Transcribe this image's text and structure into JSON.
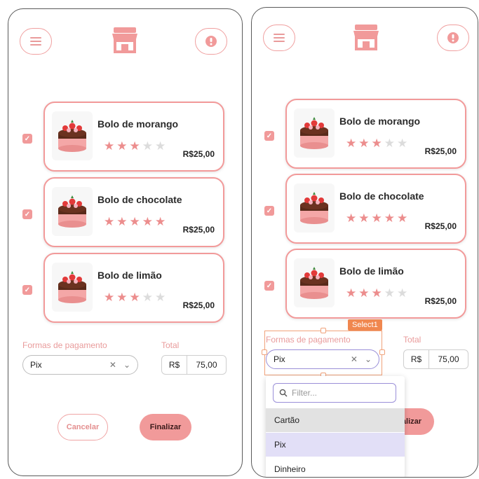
{
  "left_screen": {
    "products": [
      {
        "name": "Bolo de morango",
        "rating": 3,
        "price": "R$25,00",
        "checked": true
      },
      {
        "name": "Bolo de chocolate",
        "rating": 5,
        "price": "R$25,00",
        "checked": true
      },
      {
        "name": "Bolo de limão",
        "rating": 3,
        "price": "R$25,00",
        "checked": true
      }
    ],
    "payment_label": "Formas de pagamento",
    "payment_value": "Pix",
    "total_label": "Total",
    "currency": "R$",
    "total_value": "75,00",
    "cancel_label": "Cancelar",
    "finalize_label": "Finalizar"
  },
  "right_screen": {
    "products": [
      {
        "name": "Bolo de morango",
        "rating": 3,
        "price": "R$25,00",
        "checked": true
      },
      {
        "name": "Bolo de chocolate",
        "rating": 5,
        "price": "R$25,00",
        "checked": true
      },
      {
        "name": "Bolo de limão",
        "rating": 3,
        "price": "R$25,00",
        "checked": true
      }
    ],
    "payment_label": "Formas de pagamento",
    "payment_value": "Pix",
    "total_label": "Total",
    "currency": "R$",
    "total_value": "75,00",
    "finalize_label_partial": "alizar",
    "component_tag": "Select1",
    "filter_placeholder": "Filter...",
    "options": [
      "Cartão",
      "Pix",
      "Dinheiro"
    ],
    "hovered_option": "Cartão",
    "selected_option": "Pix"
  },
  "colors": {
    "accent": "#f19a9a",
    "accent_light": "#f29a9a",
    "star_on": "#ec8d8d",
    "star_off": "#dcdcdc",
    "selection_orange": "#f0874f",
    "focus_purple": "#9a8fd8"
  },
  "icons": [
    "menu-icon",
    "store-icon",
    "user-icon",
    "check-icon",
    "star-icon",
    "clear-icon",
    "chevron-down-icon",
    "search-icon"
  ]
}
